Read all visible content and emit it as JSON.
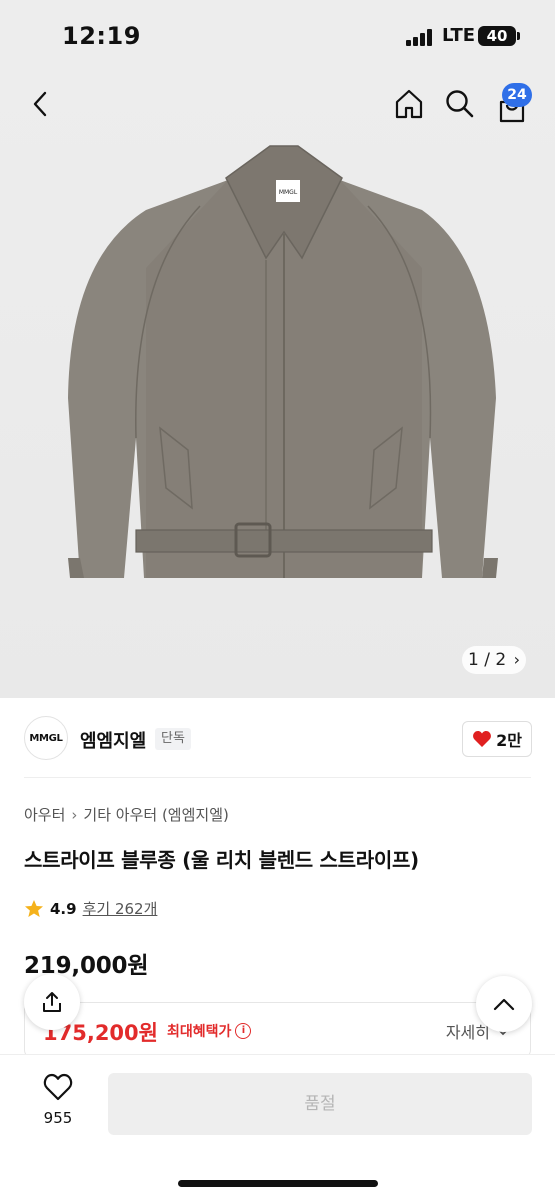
{
  "status_bar": {
    "time": "12:19",
    "network": "LTE",
    "battery": "40"
  },
  "header": {
    "icons": [
      "back-arrow-icon",
      "home-icon",
      "search-icon",
      "cart-icon"
    ],
    "cart_count": "24"
  },
  "gallery": {
    "page_indicator": "1 / 2",
    "garment_label": "MMGL"
  },
  "brand": {
    "logo_text": "MMGL",
    "name": "엠엠지엘",
    "tag": "단독",
    "likes": "2만"
  },
  "product": {
    "breadcrumb": [
      "아우터",
      "기타 아우터 (엠엠지엘)"
    ],
    "title": "스트라이프 블루종 (울 리치 블렌드 스트라이프)",
    "rating": "4.9",
    "review_label": "후기 262개",
    "price": "219,000원"
  },
  "benefit": {
    "price": "175,200원",
    "label": "최대혜택가",
    "info_icon": "i",
    "detail_label": "자세히"
  },
  "bottom_bar": {
    "wish_count": "955",
    "buy_label": "품절"
  },
  "colors": {
    "accent_red": "#e22b2b",
    "badge_blue": "#2f6fe8",
    "heart": "#e02020"
  }
}
